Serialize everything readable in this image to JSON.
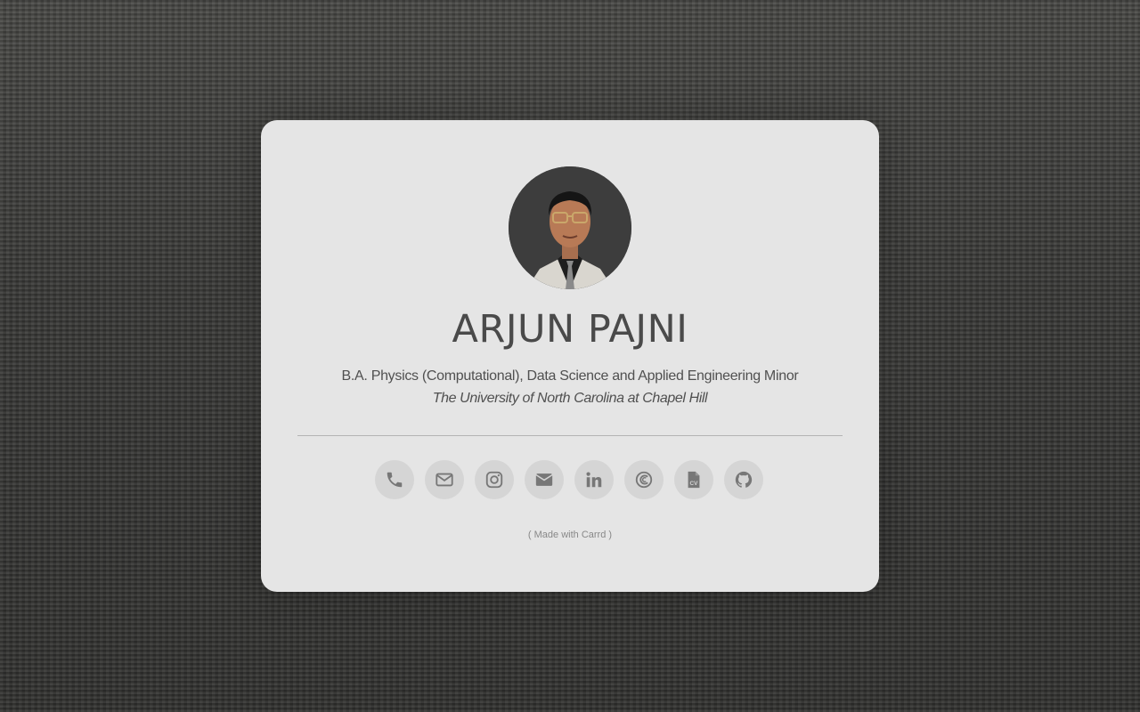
{
  "profile": {
    "name": "ARJUN PAJNI",
    "degree": "B.A. Physics (Computational), Data Science and Applied Engineering Minor",
    "school": "The University of North Carolina at Chapel Hill",
    "avatar_alt": "profile-photo"
  },
  "links": [
    {
      "icon": "phone-icon"
    },
    {
      "icon": "envelope-outline-icon"
    },
    {
      "icon": "instagram-icon"
    },
    {
      "icon": "envelope-solid-icon"
    },
    {
      "icon": "linkedin-icon"
    },
    {
      "icon": "carrd-icon"
    },
    {
      "icon": "cv-file-icon"
    },
    {
      "icon": "github-icon"
    }
  ],
  "footer": {
    "credit": "( Made with Carrd )"
  },
  "colors": {
    "card_background": "#e5e5e5",
    "icon_circle": "#d5d5d5",
    "icon_glyph": "#777777",
    "text": "#4a4a4a"
  }
}
